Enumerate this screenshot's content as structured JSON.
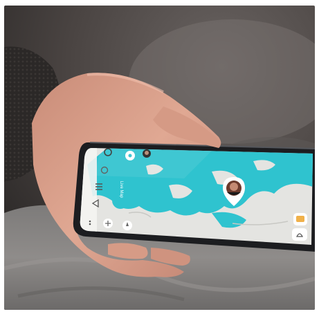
{
  "photo": {
    "subject": "hand-holding-smartphone",
    "colors": {
      "background": "#4a4542",
      "sweater": "#2b2827",
      "blanket": "#8d8a88",
      "skin": "#d9a089",
      "phone": "#1c1d20",
      "water": "#2fc3cf",
      "land": "#e4e4e1"
    }
  },
  "app": {
    "side_button_label": "Live Map",
    "icons": [
      "settings-icon",
      "layers-icon",
      "menu-icon",
      "share-icon",
      "more-icon",
      "locate-icon",
      "zoom-icon",
      "avatar-pin-icon",
      "chat-icon"
    ]
  }
}
